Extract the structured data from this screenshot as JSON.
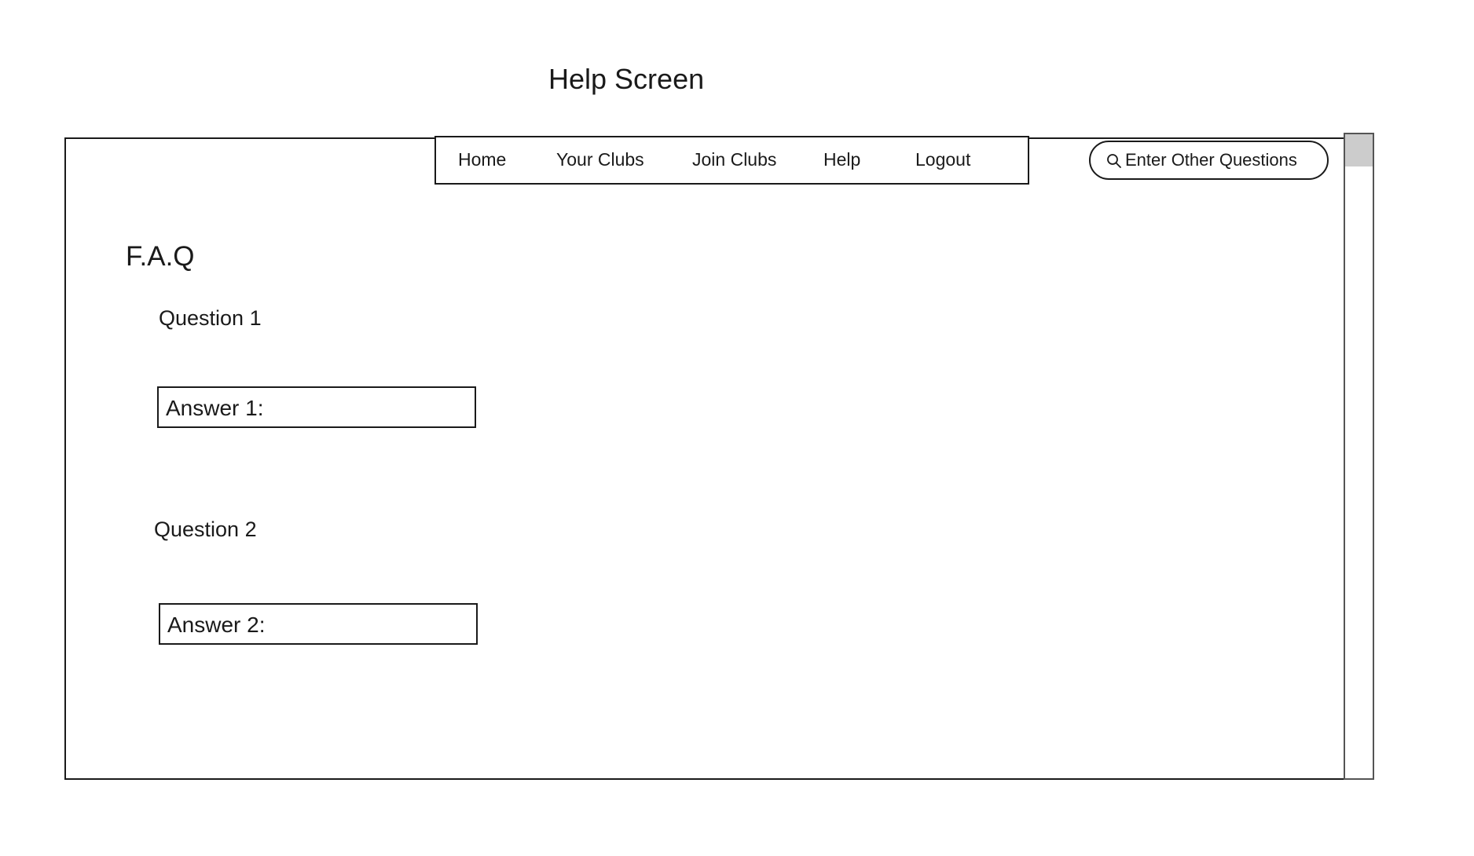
{
  "page": {
    "title": "Help Screen"
  },
  "nav": {
    "items": [
      {
        "label": "Home"
      },
      {
        "label": "Your Clubs"
      },
      {
        "label": "Join Clubs"
      },
      {
        "label": "Help"
      },
      {
        "label": "Logout"
      }
    ]
  },
  "search": {
    "icon": "search-icon",
    "placeholder": "Enter Other Questions",
    "value": ""
  },
  "faq": {
    "heading": "F.A.Q",
    "items": [
      {
        "question": "Question 1",
        "answer": "Answer 1:"
      },
      {
        "question": "Question 2",
        "answer": "Answer 2:"
      }
    ]
  },
  "scrollbar": {
    "position": 0
  }
}
